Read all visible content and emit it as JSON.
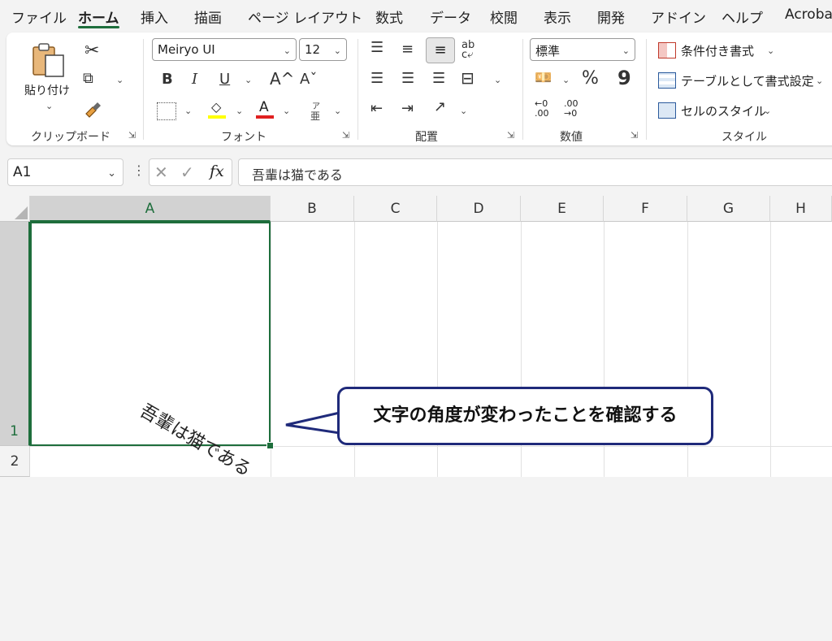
{
  "menu": {
    "tabs": [
      "ファイル",
      "ホーム",
      "挿入",
      "描画",
      "ページ レイアウト",
      "数式",
      "データ",
      "校閲",
      "表示",
      "開発",
      "アドイン",
      "ヘルプ",
      "Acrobat"
    ],
    "active": "ホーム"
  },
  "ribbon": {
    "clipboard": {
      "paste_label": "貼り付け",
      "group_label": "クリップボード",
      "icons": [
        "paste-icon",
        "cut-icon",
        "copy-icon",
        "format-painter-icon"
      ]
    },
    "font": {
      "font_name": "Meiryo UI",
      "font_size": "12",
      "bold": "B",
      "italic": "I",
      "underline": "U",
      "grow": "A^",
      "shrink": "Aˇ",
      "phonetic_top": "ア",
      "phonetic_bottom": "亜",
      "group_label": "フォント",
      "highlight_color": "#ffff00",
      "font_color": "#e02020"
    },
    "alignment": {
      "group_label": "配置"
    },
    "number": {
      "format": "標準",
      "percent": "%",
      "comma": "9",
      "inc_top": "←0",
      "inc_bottom": ".00",
      "dec_top": ".00",
      "dec_bottom": "→0",
      "group_label": "数値"
    },
    "styles": {
      "conditional": "条件付き書式",
      "as_table": "テーブルとして書式設定",
      "cell_styles": "セルのスタイル",
      "group_label": "スタイル"
    }
  },
  "formula_bar": {
    "name_box": "A1",
    "fx": "fx",
    "content": "吾輩は猫である"
  },
  "sheet": {
    "columns": [
      "A",
      "B",
      "C",
      "D",
      "E",
      "F",
      "G",
      "H"
    ],
    "rows": [
      "1",
      "2"
    ],
    "selected_cell": "A1",
    "cell_a1_text": "吾輩は猫である",
    "cell_a1_rotation_deg": 30
  },
  "callout": {
    "text": "文字の角度が変わったことを確認する",
    "border_color": "#1f2a7a"
  },
  "colors": {
    "accent": "#1e6e3c"
  }
}
